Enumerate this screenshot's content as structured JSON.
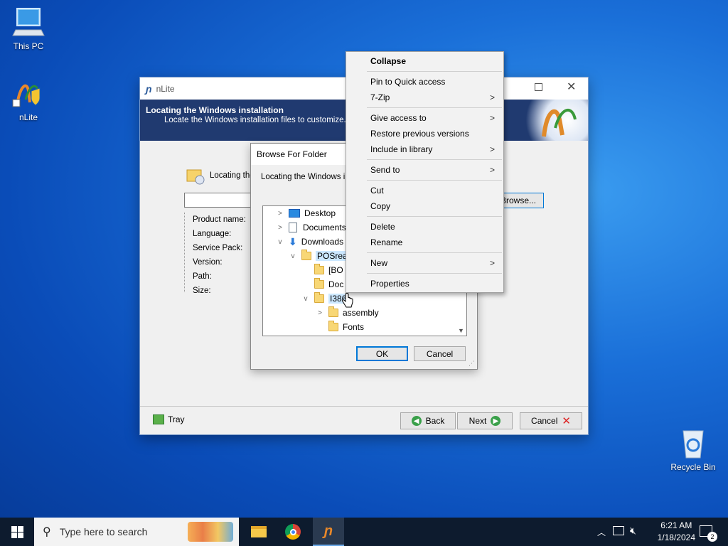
{
  "desktop": {
    "icons": [
      {
        "label": "This PC",
        "icon": "computer-icon"
      },
      {
        "label": "nLite",
        "icon": "nlite-icon"
      },
      {
        "label": "Recycle Bin",
        "icon": "recycle-bin-icon"
      }
    ]
  },
  "nlite_window": {
    "title": "nLite",
    "header_title": "Locating the Windows installation",
    "header_subtitle": "Locate the Windows installation files to customize.",
    "locating_label": "Locating the",
    "browse_button": "Browse...",
    "fields": [
      "Product name:",
      "Language:",
      "Service Pack:",
      "Version:",
      "Path:",
      "Size:"
    ],
    "tray_button": "Tray",
    "back_button": "Back",
    "next_button": "Next",
    "cancel_button": "Cancel"
  },
  "browse_dialog": {
    "title": "Browse For Folder",
    "description": "Locating the Windows ins",
    "tree": [
      {
        "label": "Desktop",
        "expander": ">"
      },
      {
        "label": "Documents",
        "expander": ">"
      },
      {
        "label": "Downloads",
        "expander": "v"
      },
      {
        "label": "POSrea",
        "expander": "v"
      },
      {
        "label": "[BO",
        "expander": ""
      },
      {
        "label": "Doc",
        "expander": ""
      },
      {
        "label": "I386",
        "expander": "v"
      },
      {
        "label": "assembly",
        "expander": ">"
      },
      {
        "label": "Fonts",
        "expander": ""
      }
    ],
    "ok_button": "OK",
    "cancel_button": "Cancel"
  },
  "context_menu": {
    "items": [
      {
        "label": "Collapse",
        "bold": true,
        "submenu": false
      },
      {
        "label": "Pin to Quick access",
        "submenu": false
      },
      {
        "label": "7-Zip",
        "submenu": true
      },
      {
        "label": "Give access to",
        "submenu": true
      },
      {
        "label": "Restore previous versions",
        "submenu": false
      },
      {
        "label": "Include in library",
        "submenu": true
      },
      {
        "label": "Send to",
        "submenu": true
      },
      {
        "label": "Cut",
        "submenu": false
      },
      {
        "label": "Copy",
        "submenu": false
      },
      {
        "label": "Delete",
        "submenu": false
      },
      {
        "label": "Rename",
        "submenu": false
      },
      {
        "label": "New",
        "submenu": true
      },
      {
        "label": "Properties",
        "submenu": false
      }
    ],
    "submenu_arrow": ">"
  },
  "taskbar": {
    "search_placeholder": "Type here to search",
    "time": "6:21 AM",
    "date": "1/18/2024",
    "notification_count": "2"
  },
  "colors": {
    "accent": "#0078d7",
    "header_bg": "#203a70",
    "taskbar_bg": "#0d1b2e"
  }
}
